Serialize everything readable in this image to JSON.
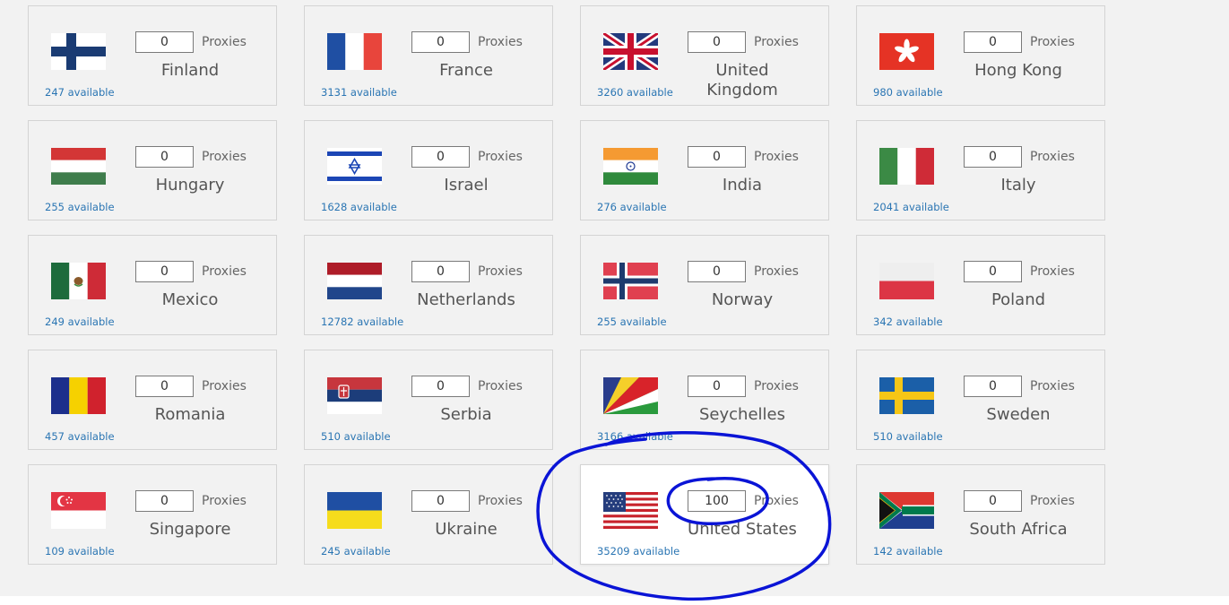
{
  "unit_label": "Proxies",
  "colors": {
    "annotation": "#0a14d6",
    "available_link": "#2a75b3",
    "card_border": "#d4d4d4",
    "panel_background": "#f2f2f2"
  },
  "countries": [
    {
      "name": "Finland",
      "flag": "finland-flag-icon",
      "quantity": "0",
      "available": "247 available",
      "selected": false
    },
    {
      "name": "France",
      "flag": "france-flag-icon",
      "quantity": "0",
      "available": "3131 available",
      "selected": false
    },
    {
      "name": "United Kingdom",
      "flag": "united-kingdom-flag-icon",
      "quantity": "0",
      "available": "3260 available",
      "selected": false
    },
    {
      "name": "Hong Kong",
      "flag": "hong-kong-flag-icon",
      "quantity": "0",
      "available": "980 available",
      "selected": false
    },
    {
      "name": "Hungary",
      "flag": "hungary-flag-icon",
      "quantity": "0",
      "available": "255 available",
      "selected": false
    },
    {
      "name": "Israel",
      "flag": "israel-flag-icon",
      "quantity": "0",
      "available": "1628 available",
      "selected": false
    },
    {
      "name": "India",
      "flag": "india-flag-icon",
      "quantity": "0",
      "available": "276 available",
      "selected": false
    },
    {
      "name": "Italy",
      "flag": "italy-flag-icon",
      "quantity": "0",
      "available": "2041 available",
      "selected": false
    },
    {
      "name": "Mexico",
      "flag": "mexico-flag-icon",
      "quantity": "0",
      "available": "249 available",
      "selected": false
    },
    {
      "name": "Netherlands",
      "flag": "netherlands-flag-icon",
      "quantity": "0",
      "available": "12782 available",
      "selected": false
    },
    {
      "name": "Norway",
      "flag": "norway-flag-icon",
      "quantity": "0",
      "available": "255 available",
      "selected": false
    },
    {
      "name": "Poland",
      "flag": "poland-flag-icon",
      "quantity": "0",
      "available": "342 available",
      "selected": false
    },
    {
      "name": "Romania",
      "flag": "romania-flag-icon",
      "quantity": "0",
      "available": "457 available",
      "selected": false
    },
    {
      "name": "Serbia",
      "flag": "serbia-flag-icon",
      "quantity": "0",
      "available": "510 available",
      "selected": false
    },
    {
      "name": "Seychelles",
      "flag": "seychelles-flag-icon",
      "quantity": "0",
      "available": "3166 available",
      "selected": false
    },
    {
      "name": "Sweden",
      "flag": "sweden-flag-icon",
      "quantity": "0",
      "available": "510 available",
      "selected": false
    },
    {
      "name": "Singapore",
      "flag": "singapore-flag-icon",
      "quantity": "0",
      "available": "109 available",
      "selected": false
    },
    {
      "name": "Ukraine",
      "flag": "ukraine-flag-icon",
      "quantity": "0",
      "available": "245 available",
      "selected": false
    },
    {
      "name": "United States",
      "flag": "united-states-flag-icon",
      "quantity": "100",
      "available": "35209 available",
      "selected": true
    },
    {
      "name": "South Africa",
      "flag": "south-africa-flag-icon",
      "quantity": "0",
      "available": "142 available",
      "selected": false
    }
  ]
}
